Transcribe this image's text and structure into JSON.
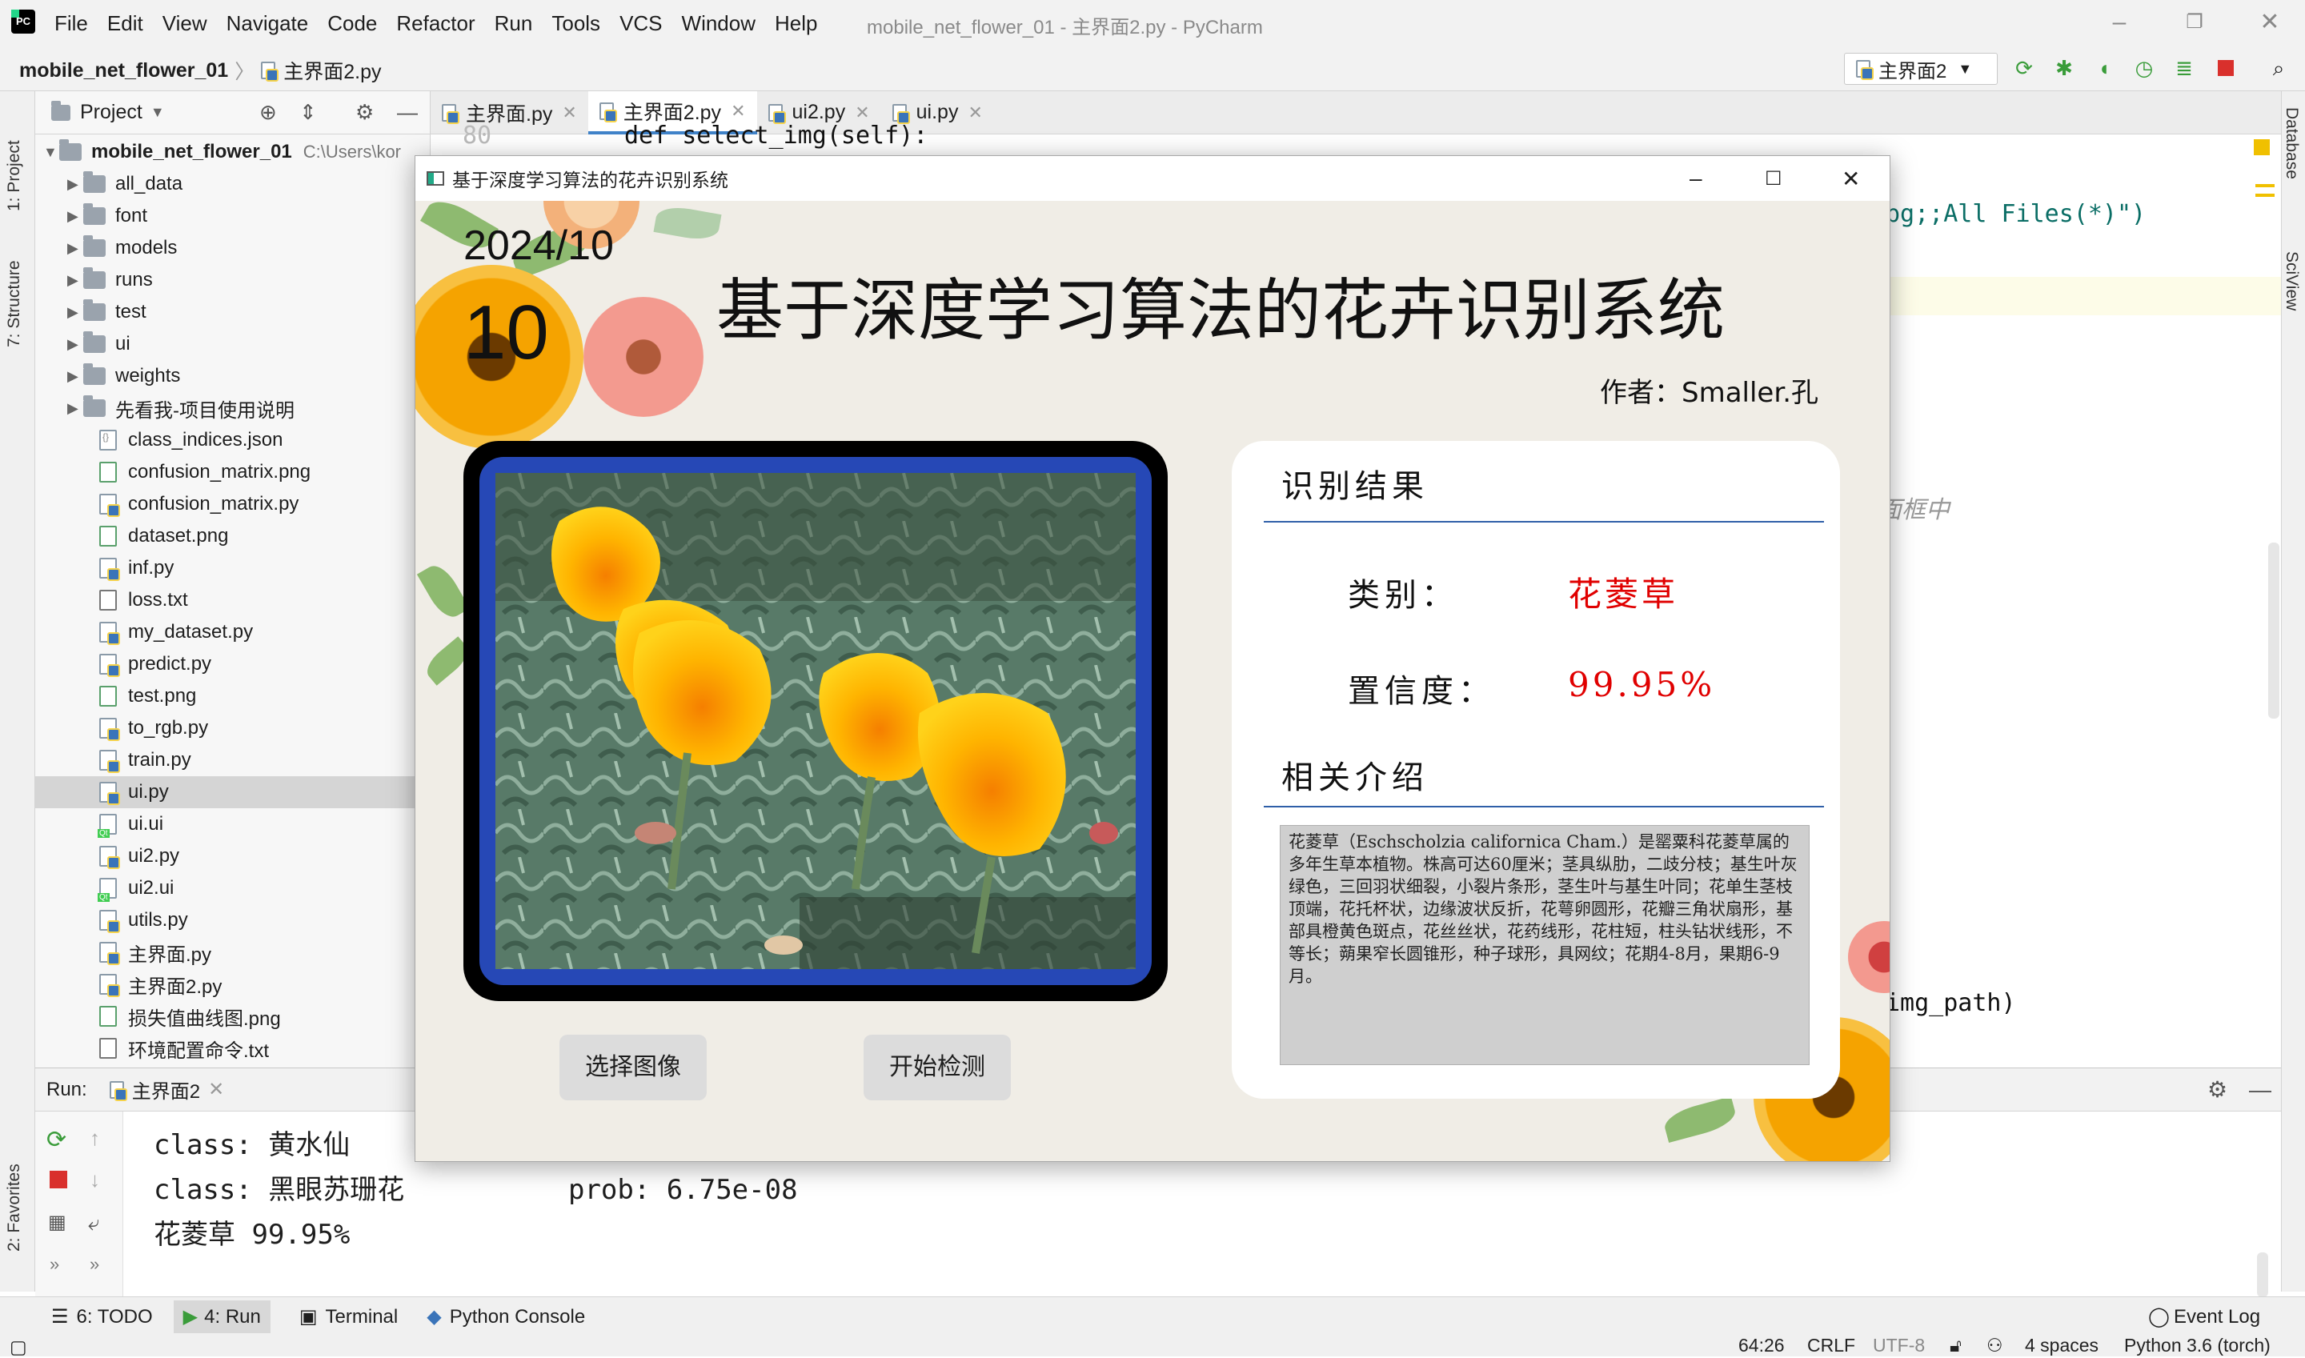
{
  "ide": {
    "menu": [
      "File",
      "Edit",
      "View",
      "Navigate",
      "Code",
      "Refactor",
      "Run",
      "Tools",
      "VCS",
      "Window",
      "Help"
    ],
    "window_title": "mobile_net_flower_01 - 主界面2.py - PyCharm",
    "breadcrumb_project": "mobile_net_flower_01",
    "breadcrumb_file": "主界面2.py",
    "run_config": "主界面2",
    "side_tabs": {
      "project": "1: Project",
      "structure": "7: Structure",
      "favorites": "2: Favorites",
      "database": "Database",
      "sciview": "SciView"
    },
    "project_panel": {
      "title": "Project",
      "root": "mobile_net_flower_01",
      "root_path": "C:\\Users\\kor",
      "folders": [
        "all_data",
        "font",
        "models",
        "runs",
        "test",
        "ui",
        "weights",
        "先看我-项目使用说明"
      ],
      "files": [
        {
          "name": "class_indices.json",
          "kind": "json"
        },
        {
          "name": "confusion_matrix.png",
          "kind": "png"
        },
        {
          "name": "confusion_matrix.py",
          "kind": "py"
        },
        {
          "name": "dataset.png",
          "kind": "png"
        },
        {
          "name": "inf.py",
          "kind": "py"
        },
        {
          "name": "loss.txt",
          "kind": "txt"
        },
        {
          "name": "my_dataset.py",
          "kind": "py"
        },
        {
          "name": "predict.py",
          "kind": "py"
        },
        {
          "name": "test.png",
          "kind": "png"
        },
        {
          "name": "to_rgb.py",
          "kind": "py"
        },
        {
          "name": "train.py",
          "kind": "py"
        },
        {
          "name": "ui.py",
          "kind": "py",
          "selected": true
        },
        {
          "name": "ui.ui",
          "kind": "qt"
        },
        {
          "name": "ui2.py",
          "kind": "py"
        },
        {
          "name": "ui2.ui",
          "kind": "qt"
        },
        {
          "name": "utils.py",
          "kind": "py"
        },
        {
          "name": "主界面.py",
          "kind": "py"
        },
        {
          "name": "主界面2.py",
          "kind": "py"
        },
        {
          "name": "损失值曲线图.png",
          "kind": "png"
        },
        {
          "name": "环境配置命令.txt",
          "kind": "txt"
        }
      ]
    },
    "editor_tabs": [
      {
        "label": "主界面.py",
        "active": false
      },
      {
        "label": "主界面2.py",
        "active": true
      },
      {
        "label": "ui2.py",
        "active": false
      },
      {
        "label": "ui.py",
        "active": false
      }
    ],
    "code_fragments": {
      "line_top": "def select_img(self):",
      "line_filter": "pg;;All Files(*)\")",
      "line_comment": "面框中",
      "line_path": "img_path)",
      "line_no": "80"
    },
    "run_panel": {
      "label": "Run:",
      "tab": "主界面2",
      "lines": [
        "class: 黄水仙",
        "class: 黑眼苏珊花          prob: 6.75e-08",
        "花菱草 99.95%"
      ]
    },
    "bottom_tools": [
      "6: TODO",
      "4: Run",
      "Terminal",
      "Python Console"
    ],
    "event_log": "Event Log",
    "status": {
      "position": "64:26",
      "line_sep": "CRLF",
      "encoding": "UTF-8",
      "indent": "4 spaces",
      "interpreter": "Python 3.6 (torch)"
    }
  },
  "app": {
    "window_title": "基于深度学习算法的花卉识别系统",
    "date_ym": "2024/10",
    "date_day": "10",
    "main_title": "基于深度学习算法的花卉识别系统",
    "author": "作者：Smaller.孔",
    "buttons": {
      "select": "选择图像",
      "detect": "开始检测"
    },
    "result": {
      "heading": "识别结果",
      "class_label": "类别：",
      "class_value": "花菱草",
      "confidence_label": "置信度：",
      "confidence_value": "99.95%",
      "intro_heading": "相关介绍",
      "intro_text": "花菱草（Eschscholzia californica Cham.）是罂粟科花菱草属的多年生草本植物。株高可达60厘米；茎具纵肋，二歧分枝；基生叶灰绿色，三回羽状细裂，小裂片条形，茎生叶与基生叶同；花单生茎枝顶端，花托杯状，边缘波状反折，花萼卵圆形，花瓣三角状扇形，基部具橙黄色斑点，花丝丝状，花药线形，花柱短，柱头钻状线形，不等长；蒴果窄长圆锥形，种子球形，具网纹；花期4-8月，果期6-9月。"
    }
  },
  "colors": {
    "accent": "#4083c9",
    "frame_blue": "#2648b6",
    "red_value": "#e00000",
    "card_line": "#2f5fa8"
  }
}
